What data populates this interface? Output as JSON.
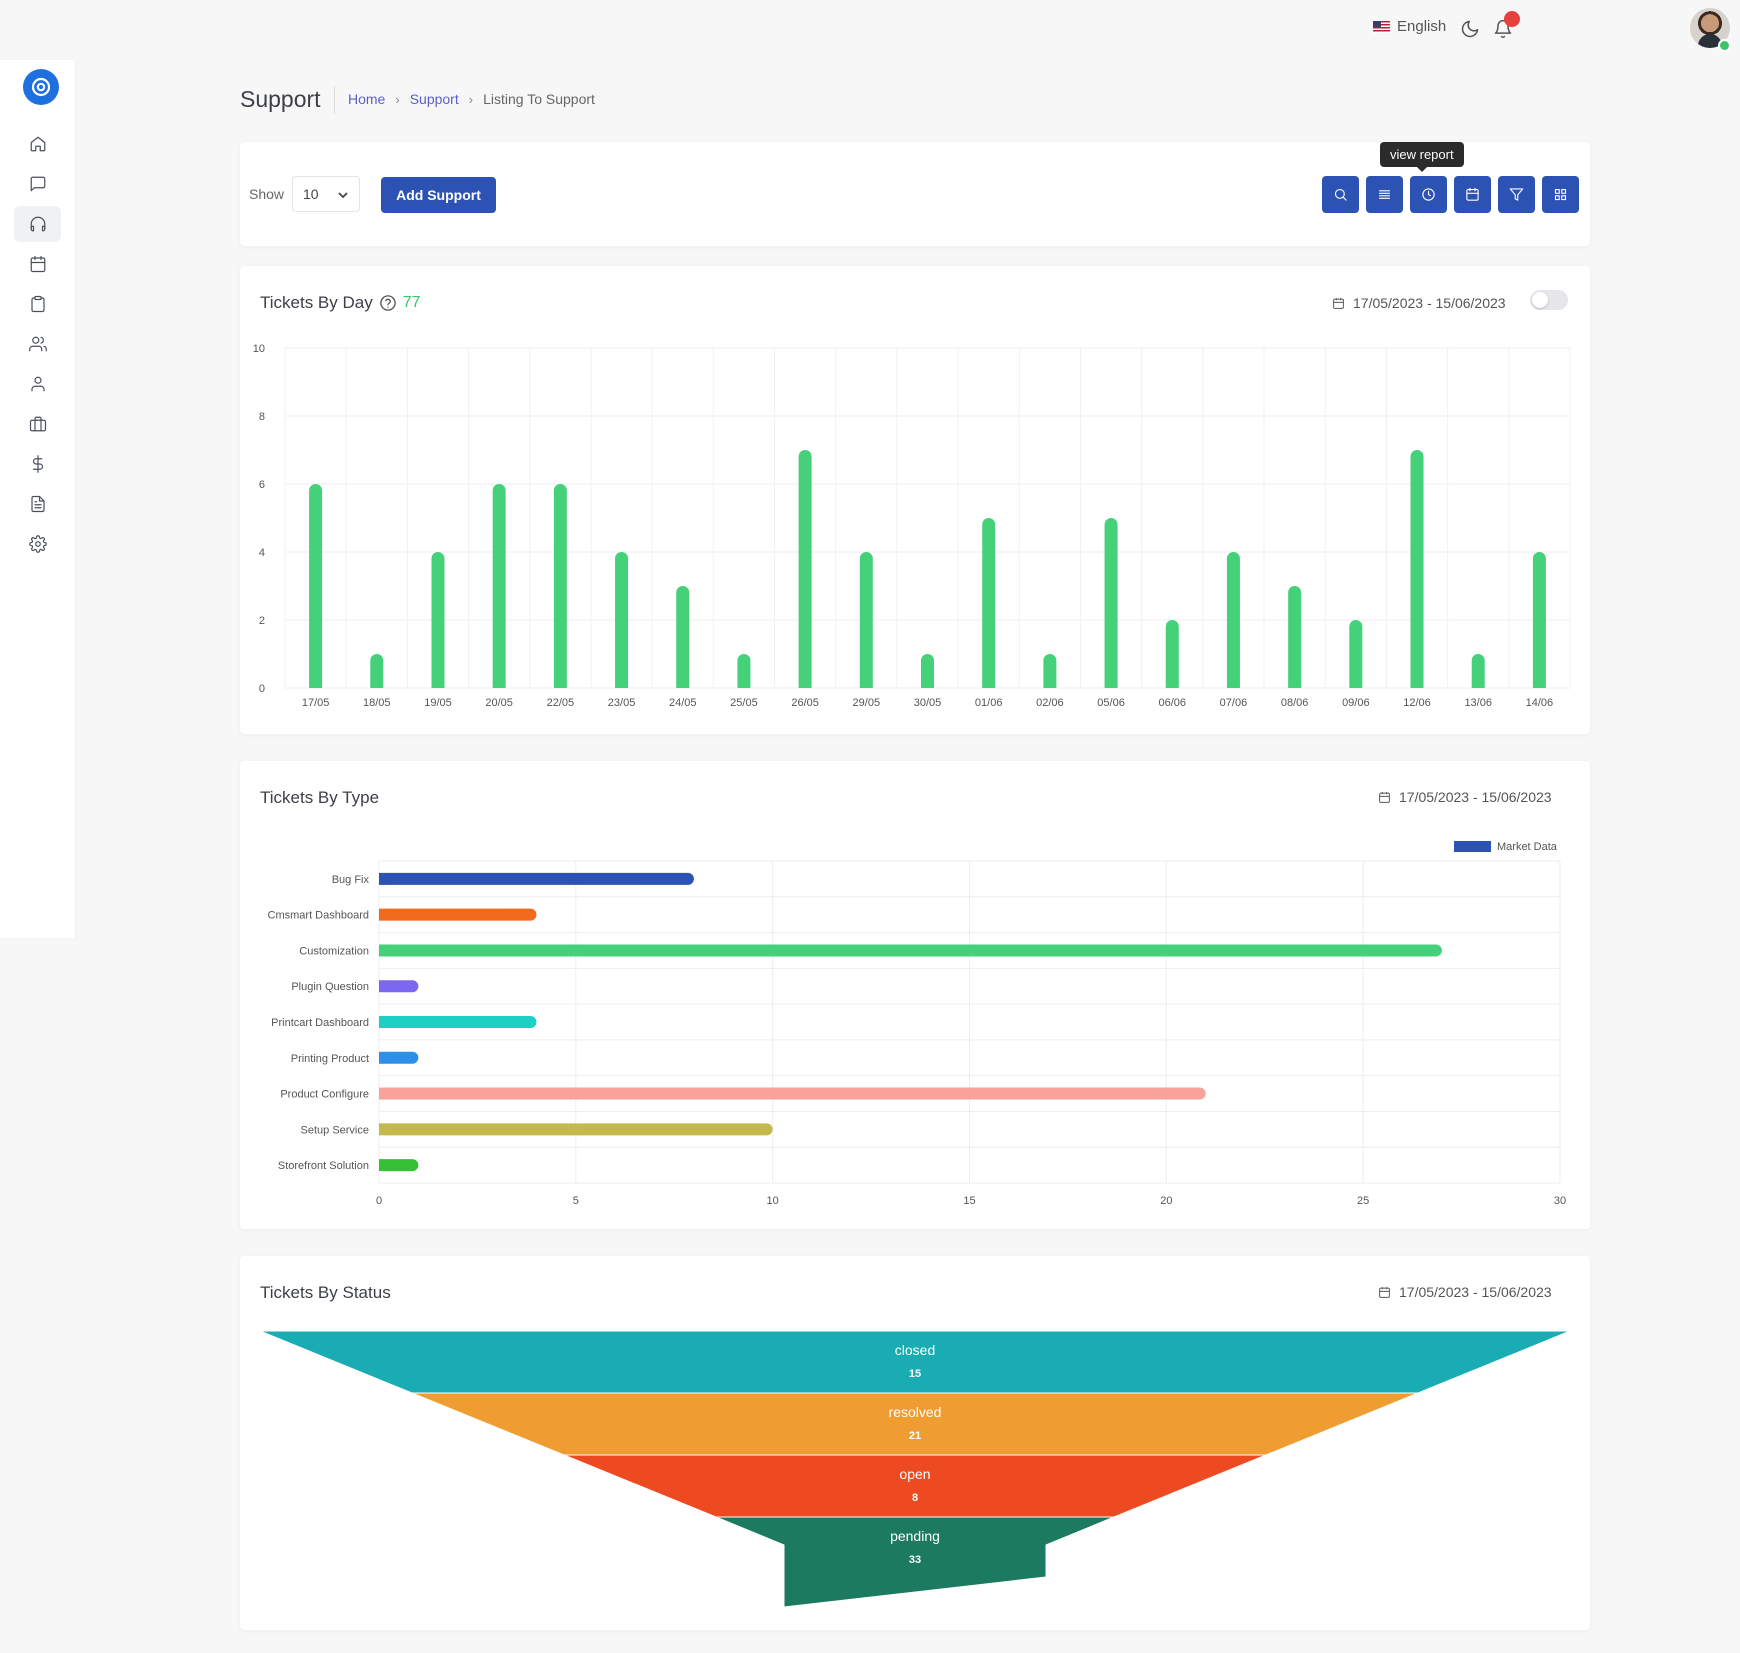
{
  "header": {
    "language": "English"
  },
  "sidebar": {
    "items": [
      {
        "icon": "home-icon"
      },
      {
        "icon": "message-icon"
      },
      {
        "icon": "headphones-icon",
        "active": true
      },
      {
        "icon": "calendar-icon"
      },
      {
        "icon": "clipboard-icon"
      },
      {
        "icon": "users-icon"
      },
      {
        "icon": "user-icon"
      },
      {
        "icon": "briefcase-icon"
      },
      {
        "icon": "dollar-icon"
      },
      {
        "icon": "file-text-icon"
      },
      {
        "icon": "settings-icon"
      }
    ]
  },
  "page": {
    "title": "Support",
    "breadcrumb": [
      "Home",
      "Support",
      "Listing To Support"
    ]
  },
  "toolbar": {
    "show_label": "Show",
    "page_size": "10",
    "add_label": "Add Support",
    "tooltip": "view report",
    "buttons": [
      "search-icon",
      "list-icon",
      "pie-chart-icon",
      "calendar-icon",
      "filter-icon",
      "grid-icon"
    ]
  },
  "colors": {
    "primary": "#2c52b3",
    "green": "#3cc46b"
  },
  "tickets_by_day": {
    "title": "Tickets By Day",
    "count": "77",
    "date_range": "17/05/2023 - 15/06/2023"
  },
  "tickets_by_type": {
    "title": "Tickets By Type",
    "date_range": "17/05/2023 - 15/06/2023"
  },
  "tickets_by_status": {
    "title": "Tickets By Status",
    "date_range": "17/05/2023 - 15/06/2023"
  },
  "chart_data": [
    {
      "type": "bar",
      "title": "Tickets By Day",
      "categories": [
        "17/05",
        "18/05",
        "19/05",
        "20/05",
        "22/05",
        "23/05",
        "24/05",
        "25/05",
        "26/05",
        "29/05",
        "30/05",
        "01/06",
        "02/06",
        "05/06",
        "06/06",
        "07/06",
        "08/06",
        "09/06",
        "12/06",
        "13/06",
        "14/06"
      ],
      "values": [
        6,
        1,
        4,
        6,
        6,
        4,
        3,
        1,
        7,
        4,
        1,
        5,
        1,
        5,
        2,
        4,
        3,
        2,
        7,
        1,
        4
      ],
      "ylim": [
        0,
        10
      ],
      "yticks": [
        0,
        2,
        4,
        6,
        8,
        10
      ],
      "color": "#45d17a",
      "grid": true
    },
    {
      "type": "bar",
      "orientation": "horizontal",
      "title": "Tickets By Type",
      "legend": "Market Data",
      "legend_color": "#2c52b3",
      "legend_position": "top-right",
      "categories": [
        "Bug Fix",
        "Cmsmart Dashboard",
        "Customization",
        "Plugin Question",
        "Printcart Dashboard",
        "Printing Product",
        "Product Configure",
        "Setup Service",
        "Storefront Solution"
      ],
      "values": [
        8,
        4,
        27,
        1,
        4,
        1,
        21,
        10,
        1
      ],
      "colors": [
        "#2c52b3",
        "#f26a1b",
        "#45d17a",
        "#7b68ee",
        "#1ecfc4",
        "#2e8fe8",
        "#f8a29c",
        "#c4b94c",
        "#34c234"
      ],
      "xlim": [
        0,
        30
      ],
      "xticks": [
        0,
        5,
        10,
        15,
        20,
        25,
        30
      ],
      "grid": true
    },
    {
      "type": "funnel",
      "title": "Tickets By Status",
      "stages": [
        {
          "label": "closed",
          "value": 15,
          "color": "#19adb3"
        },
        {
          "label": "resolved",
          "value": 21,
          "color": "#ef9d32"
        },
        {
          "label": "open",
          "value": 8,
          "color": "#ed4a22"
        },
        {
          "label": "pending",
          "value": 33,
          "color": "#1b7a5f"
        }
      ]
    }
  ]
}
